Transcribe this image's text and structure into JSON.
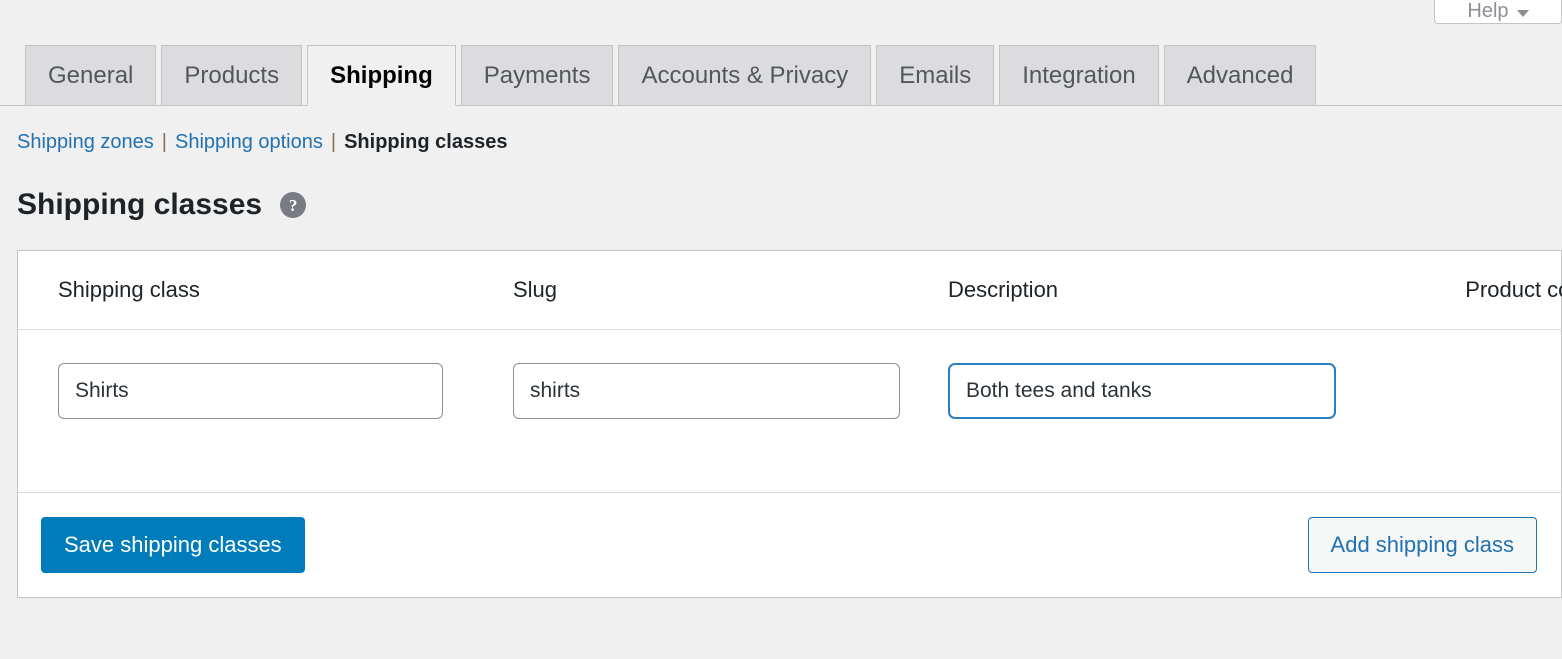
{
  "help_tab": {
    "label": "Help",
    "caret_icon": "chevron-down-icon"
  },
  "tabs": [
    {
      "label": "General",
      "active": false
    },
    {
      "label": "Products",
      "active": false
    },
    {
      "label": "Shipping",
      "active": true
    },
    {
      "label": "Payments",
      "active": false
    },
    {
      "label": "Accounts & Privacy",
      "active": false
    },
    {
      "label": "Emails",
      "active": false
    },
    {
      "label": "Integration",
      "active": false
    },
    {
      "label": "Advanced",
      "active": false
    }
  ],
  "subnav": {
    "items": [
      {
        "label": "Shipping zones",
        "current": false
      },
      {
        "label": "Shipping options",
        "current": false
      },
      {
        "label": "Shipping classes",
        "current": true
      }
    ],
    "separator": "|"
  },
  "heading": {
    "title": "Shipping classes",
    "help_tip_icon": "question-mark-icon",
    "help_tip_glyph": "?"
  },
  "table": {
    "columns": [
      {
        "key": "name",
        "label": "Shipping class"
      },
      {
        "key": "slug",
        "label": "Slug"
      },
      {
        "key": "desc",
        "label": "Description"
      },
      {
        "key": "count",
        "label": "Product count"
      }
    ],
    "rows": [
      {
        "name": "Shirts",
        "slug": "shirts",
        "description": "Both tees and tanks",
        "product_count": "",
        "name_placeholder": "",
        "slug_placeholder": "",
        "description_placeholder": "",
        "description_focused": true
      }
    ]
  },
  "footer": {
    "save_label": "Save shipping classes",
    "add_label": "Add shipping class"
  },
  "colors": {
    "page_background": "#f0f0f1",
    "card_background": "#ffffff",
    "border": "#c3c4c7",
    "link": "#2271b1",
    "primary_button": "#007cba",
    "focus_border": "#2b7fc0",
    "tab_inactive": "#dcdcde",
    "help_tip": "#787c82"
  }
}
